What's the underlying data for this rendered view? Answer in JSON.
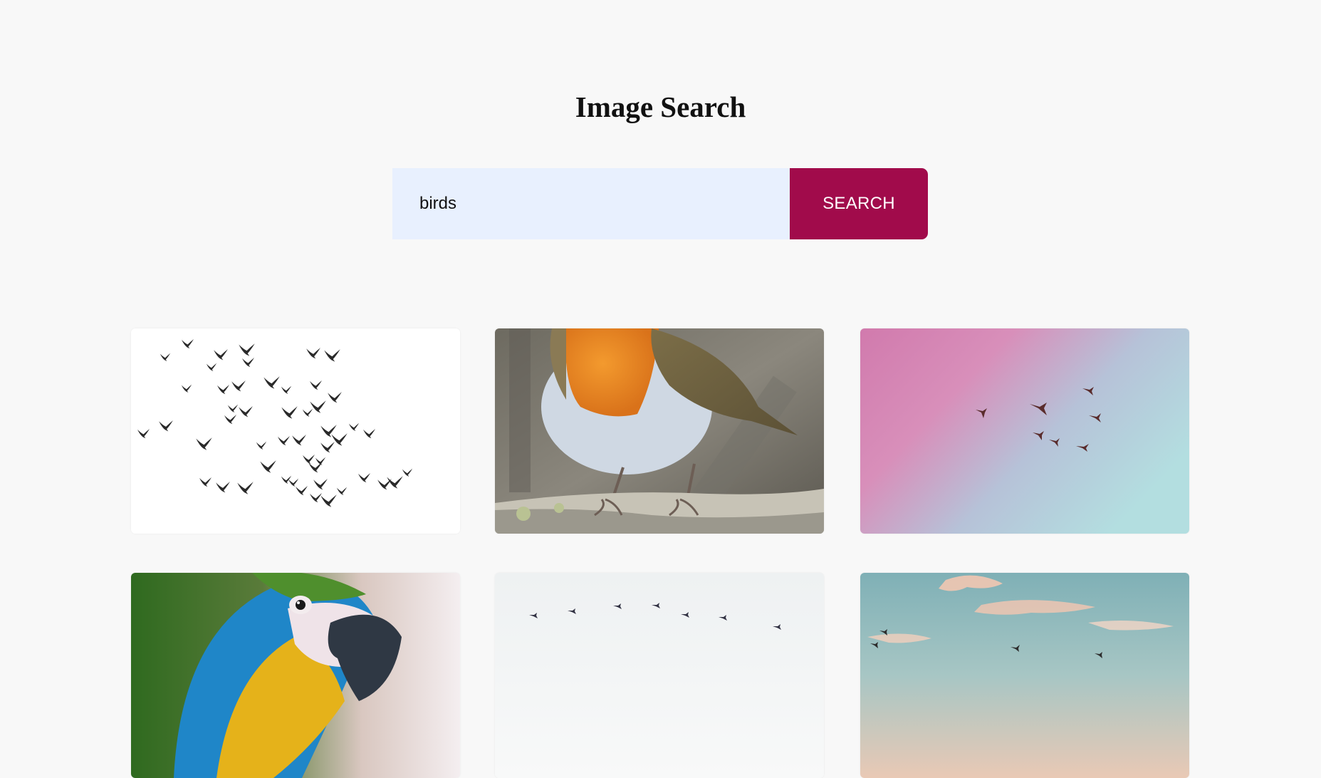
{
  "page": {
    "title": "Image Search"
  },
  "search": {
    "value": "birds",
    "button_label": "SEARCH"
  },
  "colors": {
    "background": "#f8f8f8",
    "input_background": "#e8f0fe",
    "button_background": "#a10b4b",
    "button_text": "#ffffff"
  },
  "results": [
    {
      "subject": "flock of birds silhouettes on white"
    },
    {
      "subject": "robin perched on branch"
    },
    {
      "subject": "birds flying in pink and blue sky"
    },
    {
      "subject": "blue and yellow macaw"
    },
    {
      "subject": "birds flying in a line against pale sky"
    },
    {
      "subject": "birds flying over sunset clouds"
    }
  ]
}
